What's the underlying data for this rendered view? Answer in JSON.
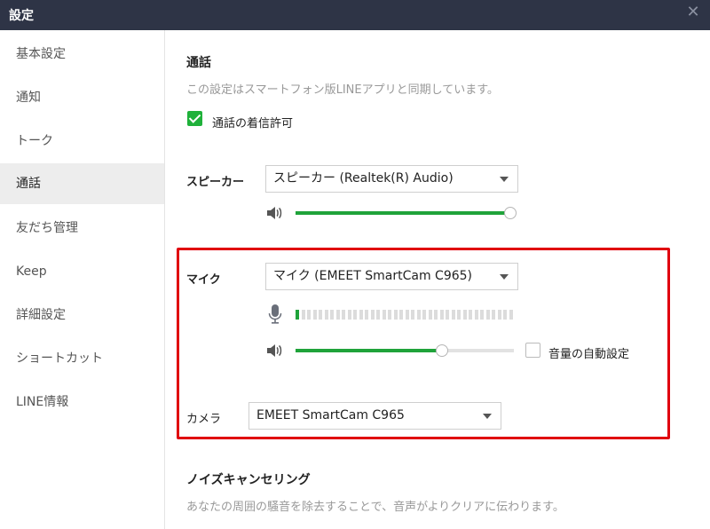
{
  "window": {
    "title": "設定"
  },
  "sidebar": {
    "items": [
      {
        "label": "基本設定"
      },
      {
        "label": "通知"
      },
      {
        "label": "トーク"
      },
      {
        "label": "通話",
        "active": true
      },
      {
        "label": "友だち管理"
      },
      {
        "label": "Keep"
      },
      {
        "label": "詳細設定"
      },
      {
        "label": "ショートカット"
      },
      {
        "label": "LINE情報"
      }
    ]
  },
  "call": {
    "title": "通話",
    "description": "この設定はスマートフォン版LINEアプリと同期しています。",
    "allow_incoming_label": "通話の着信許可",
    "allow_incoming_checked": true
  },
  "speaker": {
    "label": "スピーカー",
    "selected": "スピーカー (Realtek(R) Audio)",
    "volume_percent": 100
  },
  "mic": {
    "label": "マイク",
    "selected": "マイク (EMEET SmartCam C965)",
    "input_level_segments_total": 38,
    "input_level_segments_on": 1,
    "volume_percent": 67,
    "auto_volume_label": "音量の自動設定",
    "auto_volume_checked": false
  },
  "camera": {
    "label": "カメラ",
    "selected": "EMEET SmartCam C965"
  },
  "noise": {
    "title": "ノイズキャンセリング",
    "description": "あなたの周囲の騒音を除去することで、音声がよりクリアに伝わります。"
  },
  "colors": {
    "accent": "#1fa33a",
    "highlight": "#e0000f",
    "titlebar": "#2e3446"
  }
}
